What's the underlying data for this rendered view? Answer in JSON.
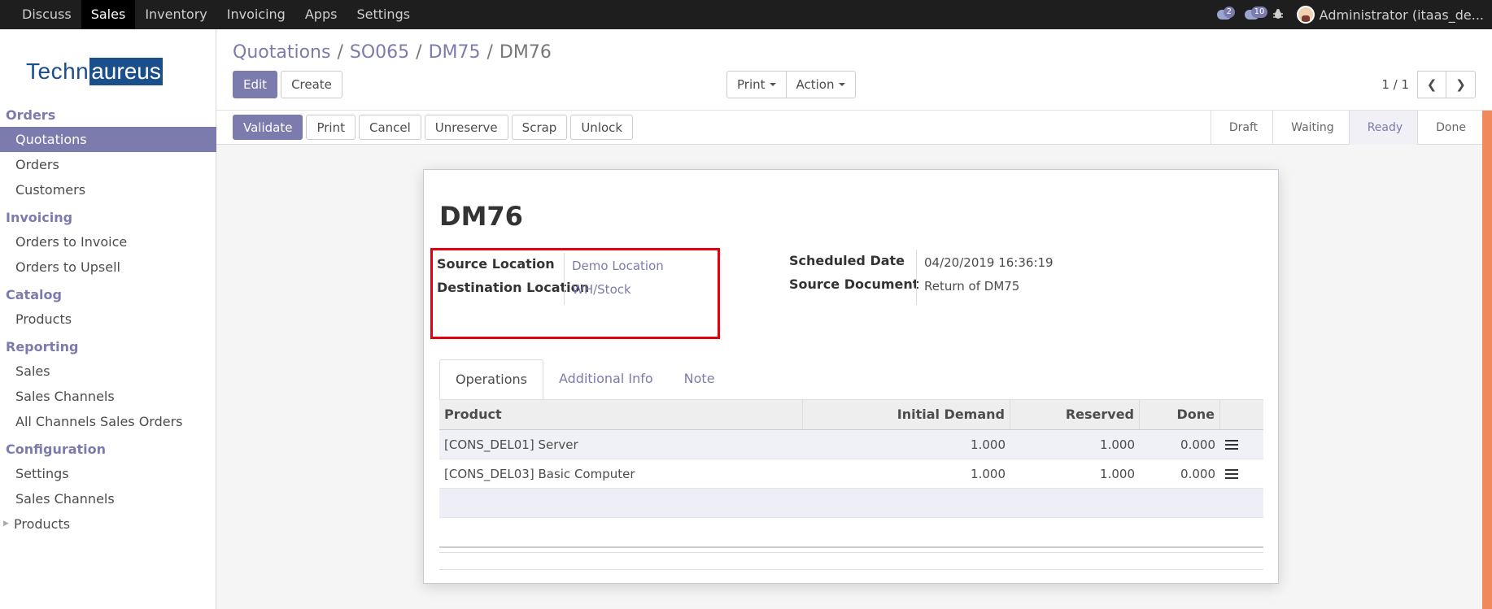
{
  "topbar": {
    "menu": [
      "Discuss",
      "Sales",
      "Inventory",
      "Invoicing",
      "Apps",
      "Settings"
    ],
    "active": "Sales",
    "chat_count": "2",
    "activity_count": "10",
    "user": "Administrator (itaas_de..."
  },
  "sidebar": {
    "logo_part1": "Techn",
    "logo_part2": "aureus",
    "groups": [
      {
        "title": "Orders",
        "items": [
          "Quotations",
          "Orders",
          "Customers"
        ]
      },
      {
        "title": "Invoicing",
        "items": [
          "Orders to Invoice",
          "Orders to Upsell"
        ]
      },
      {
        "title": "Catalog",
        "items": [
          "Products"
        ]
      },
      {
        "title": "Reporting",
        "items": [
          "Sales",
          "Sales Channels",
          "All Channels Sales Orders"
        ]
      },
      {
        "title": "Configuration",
        "items": [
          "Settings",
          "Sales Channels",
          "Products"
        ]
      }
    ],
    "active_item": "Quotations"
  },
  "breadcrumb": {
    "items": [
      "Quotations",
      "SO065",
      "DM75"
    ],
    "current": "DM76"
  },
  "buttons": {
    "edit": "Edit",
    "create": "Create",
    "print": "Print",
    "action": "Action"
  },
  "pager": {
    "value": "1 / 1"
  },
  "actions": [
    "Validate",
    "Print",
    "Cancel",
    "Unreserve",
    "Scrap",
    "Unlock"
  ],
  "stages": [
    "Draft",
    "Waiting",
    "Ready",
    "Done"
  ],
  "current_stage": "Ready",
  "record": {
    "name": "DM76",
    "source_location_label": "Source Location",
    "source_location": "Demo Location",
    "destination_location_label": "Destination Location",
    "destination_location": "WH/Stock",
    "scheduled_date_label": "Scheduled Date",
    "scheduled_date": "04/20/2019 16:36:19",
    "source_document_label": "Source Document",
    "source_document": "Return of DM75"
  },
  "tabs": [
    "Operations",
    "Additional Info",
    "Note"
  ],
  "table": {
    "headers": [
      "Product",
      "Initial Demand",
      "Reserved",
      "Done"
    ],
    "rows": [
      [
        "[CONS_DEL01] Server",
        "1.000",
        "1.000",
        "0.000"
      ],
      [
        "[CONS_DEL03] Basic Computer",
        "1.000",
        "1.000",
        "0.000"
      ]
    ]
  }
}
